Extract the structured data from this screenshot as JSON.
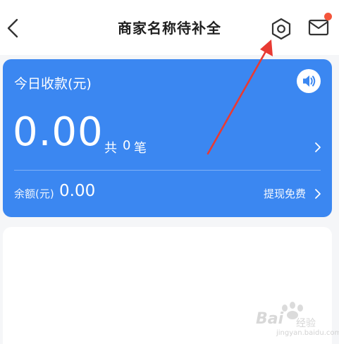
{
  "header": {
    "title": "商家名称待补全",
    "back_icon": "chevron-left-icon",
    "settings_icon": "gear-icon",
    "mail_icon": "mail-icon",
    "notify_color": "#f4553b"
  },
  "card": {
    "label": "今日收款(元)",
    "amount": "0.00",
    "count_prefix": "共",
    "count": "0",
    "count_suffix": "笔",
    "balance_label": "余额(元)",
    "balance_value": "0.00",
    "withdraw_label": "提现免费",
    "sound_icon": "speaker-icon",
    "background": "#3b87f1"
  },
  "watermark": {
    "brand": "Bai",
    "sub": "经验",
    "url": "jingyan.baidu.com"
  }
}
